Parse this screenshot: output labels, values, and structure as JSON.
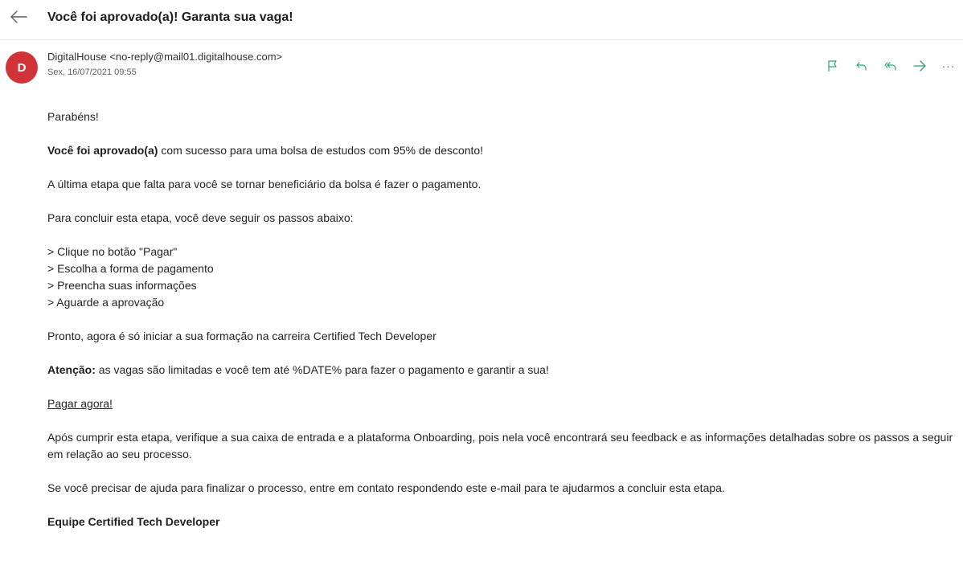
{
  "subject": "Você foi aprovado(a)! Garanta sua vaga!",
  "sender": {
    "avatar_initial": "D",
    "avatar_color": "#d13438",
    "display": "DigitalHouse <no-reply@mail01.digitalhouse.com>",
    "date": "Sex, 16/07/2021 09:55"
  },
  "icons": {
    "back": "back-arrow-icon",
    "flag": "flag-icon",
    "reply": "reply-icon",
    "reply_all": "reply-all-icon",
    "forward": "forward-icon",
    "more": "more-icon",
    "action_color": "#2aa37a"
  },
  "more_glyph": "···",
  "message": {
    "greeting": "Parabéns!",
    "approved_bold": "Você foi aprovado(a)",
    "approved_rest": " com sucesso para uma bolsa de estudos com 95% de desconto!",
    "last_step": "A última etapa que falta para você se tornar beneficiário da bolsa é fazer o pagamento.",
    "steps_intro": "Para concluir esta etapa, você deve seguir os passos abaixo:",
    "steps": [
      "> Clique no botão \"Pagar\"",
      "> Escolha a forma de pagamento",
      "> Preencha suas informações",
      "> Aguarde a aprovação"
    ],
    "ready": "Pronto, agora é só iniciar a sua formação na carreira Certified Tech Developer",
    "attention_bold": "Atenção:",
    "attention_rest": " as vagas são limitadas e você tem até %DATE% para fazer o pagamento e garantir a sua!",
    "pay_link": "Pagar agora!",
    "after": "Após cumprir esta etapa, verifique a sua caixa de entrada e a plataforma Onboarding, pois nela você encontrará seu feedback e as informações detalhadas sobre os passos a seguir em relação ao seu processo.",
    "help": "Se você precisar de ajuda para finalizar o processo, entre em contato respondendo este e-mail para te ajudarmos a concluir esta etapa.",
    "signature": "Equipe Certified Tech Developer"
  }
}
